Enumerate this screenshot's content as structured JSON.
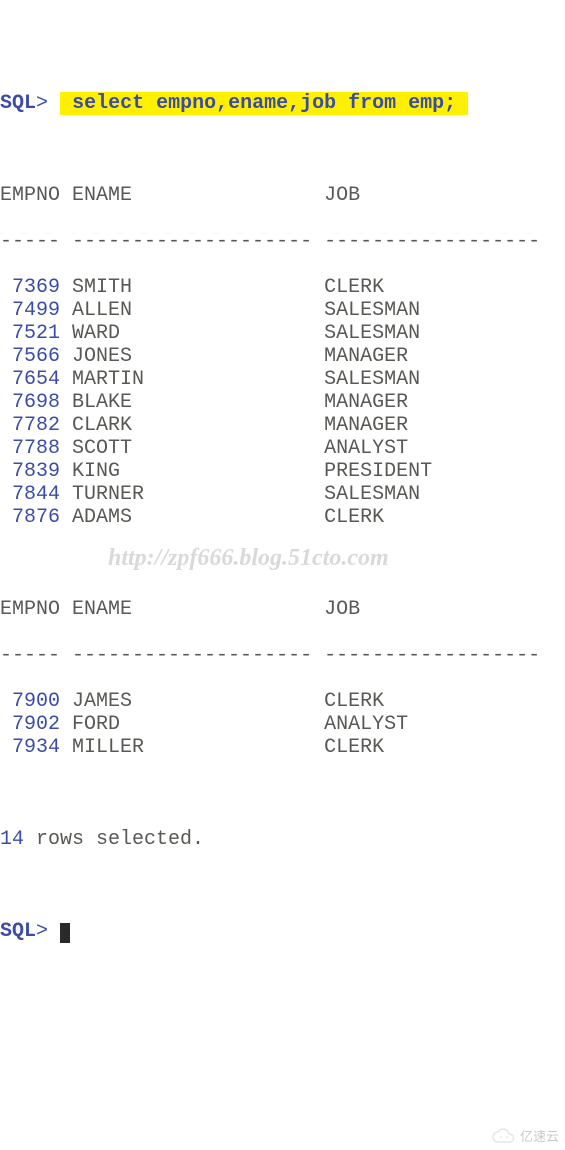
{
  "prompt1": {
    "label": "SQL",
    "sym": ">",
    "query": "select empno,ename,job from emp;"
  },
  "headers": {
    "empno": "EMPNO",
    "ename": "ENAME",
    "job": "JOB"
  },
  "dashes": {
    "empno": "-----",
    "ename": "--------------------",
    "job": "------------------"
  },
  "page1": [
    {
      "empno": "7369",
      "ename": "SMITH",
      "job": "CLERK"
    },
    {
      "empno": "7499",
      "ename": "ALLEN",
      "job": "SALESMAN"
    },
    {
      "empno": "7521",
      "ename": "WARD",
      "job": "SALESMAN"
    },
    {
      "empno": "7566",
      "ename": "JONES",
      "job": "MANAGER"
    },
    {
      "empno": "7654",
      "ename": "MARTIN",
      "job": "SALESMAN"
    },
    {
      "empno": "7698",
      "ename": "BLAKE",
      "job": "MANAGER"
    },
    {
      "empno": "7782",
      "ename": "CLARK",
      "job": "MANAGER"
    },
    {
      "empno": "7788",
      "ename": "SCOTT",
      "job": "ANALYST"
    },
    {
      "empno": "7839",
      "ename": "KING",
      "job": "PRESIDENT"
    },
    {
      "empno": "7844",
      "ename": "TURNER",
      "job": "SALESMAN"
    },
    {
      "empno": "7876",
      "ename": "ADAMS",
      "job": "CLERK"
    }
  ],
  "page2": [
    {
      "empno": "7900",
      "ename": "JAMES",
      "job": "CLERK"
    },
    {
      "empno": "7902",
      "ename": "FORD",
      "job": "ANALYST"
    },
    {
      "empno": "7934",
      "ename": "MILLER",
      "job": "CLERK"
    }
  ],
  "summary": {
    "count": "14",
    "text": " rows selected."
  },
  "prompt2": {
    "label": "SQL",
    "sym": ">"
  },
  "watermark": "http://zpf666.blog.51cto.com",
  "logo_text": "亿速云",
  "chart_data": {
    "type": "table",
    "title": "select empno,ename,job from emp;",
    "columns": [
      "EMPNO",
      "ENAME",
      "JOB"
    ],
    "rows": [
      [
        7369,
        "SMITH",
        "CLERK"
      ],
      [
        7499,
        "ALLEN",
        "SALESMAN"
      ],
      [
        7521,
        "WARD",
        "SALESMAN"
      ],
      [
        7566,
        "JONES",
        "MANAGER"
      ],
      [
        7654,
        "MARTIN",
        "SALESMAN"
      ],
      [
        7698,
        "BLAKE",
        "MANAGER"
      ],
      [
        7782,
        "CLARK",
        "MANAGER"
      ],
      [
        7788,
        "SCOTT",
        "ANALYST"
      ],
      [
        7839,
        "KING",
        "PRESIDENT"
      ],
      [
        7844,
        "TURNER",
        "SALESMAN"
      ],
      [
        7876,
        "ADAMS",
        "CLERK"
      ],
      [
        7900,
        "JAMES",
        "CLERK"
      ],
      [
        7902,
        "FORD",
        "ANALYST"
      ],
      [
        7934,
        "MILLER",
        "CLERK"
      ]
    ],
    "row_count": 14
  }
}
